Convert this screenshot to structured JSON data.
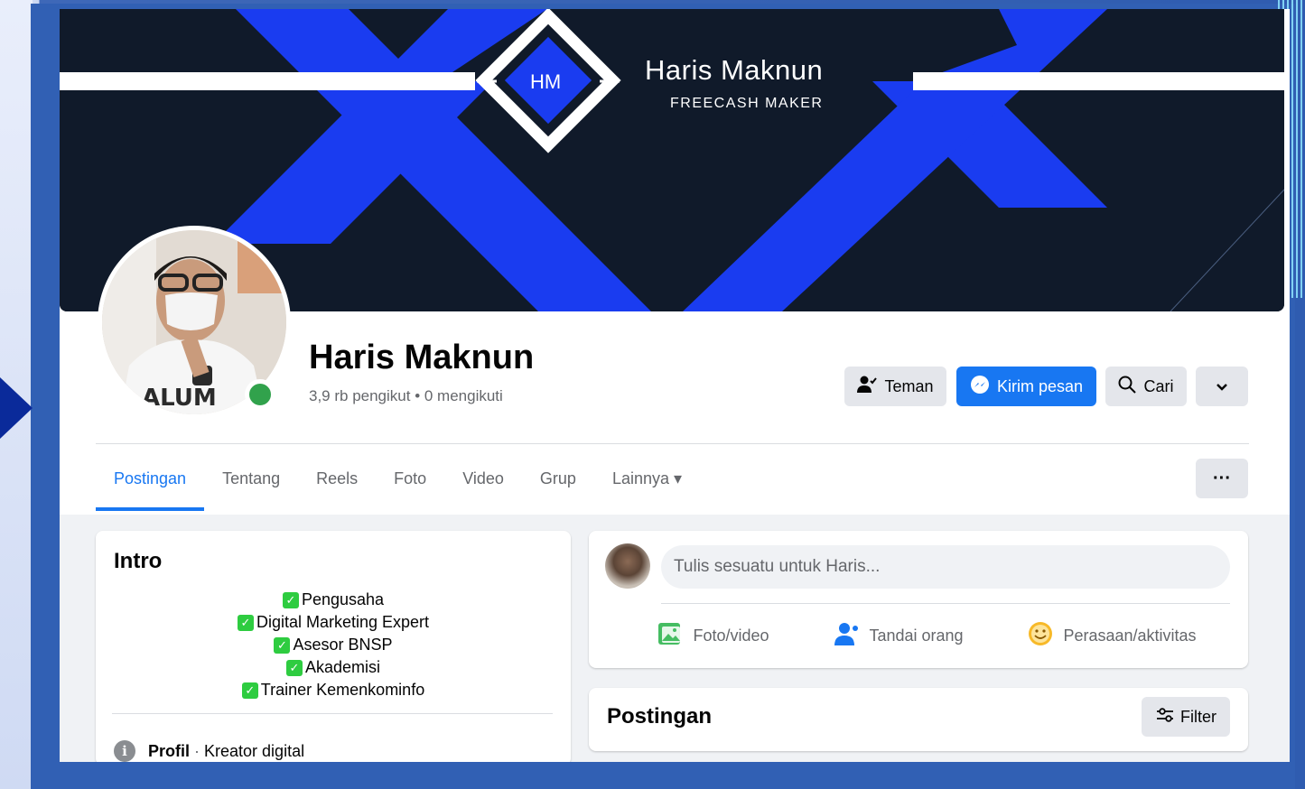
{
  "cover": {
    "logo_text": "HM",
    "title": "Haris Maknun",
    "subtitle": "FREECASH MAKER"
  },
  "profile": {
    "name": "Haris Maknun",
    "stats": "3,9 rb pengikut • 0 mengikuti"
  },
  "actions": {
    "teman": "Teman",
    "kirim_pesan": "Kirim pesan",
    "cari": "Cari"
  },
  "tabs": [
    {
      "label": "Postingan",
      "active": true
    },
    {
      "label": "Tentang"
    },
    {
      "label": "Reels"
    },
    {
      "label": "Foto"
    },
    {
      "label": "Video"
    },
    {
      "label": "Grup"
    },
    {
      "label": "Lainnya ▾"
    }
  ],
  "intro": {
    "title": "Intro",
    "items": [
      "Pengusaha",
      "Digital Marketing Expert",
      "Asesor BNSP",
      "Akademisi",
      "Trainer Kemenkominfo"
    ],
    "profile_label": "Profil",
    "profile_separator": " · ",
    "profile_value": "Kreator digital"
  },
  "composer": {
    "placeholder": "Tulis sesuatu untuk Haris...",
    "photo_video": "Foto/video",
    "tag_people": "Tandai orang",
    "feeling": "Perasaan/aktivitas"
  },
  "posts": {
    "title": "Postingan",
    "filter": "Filter"
  },
  "colors": {
    "accent": "#1877f2",
    "cover_blue": "#1a3cf0",
    "online": "#31a24c"
  }
}
